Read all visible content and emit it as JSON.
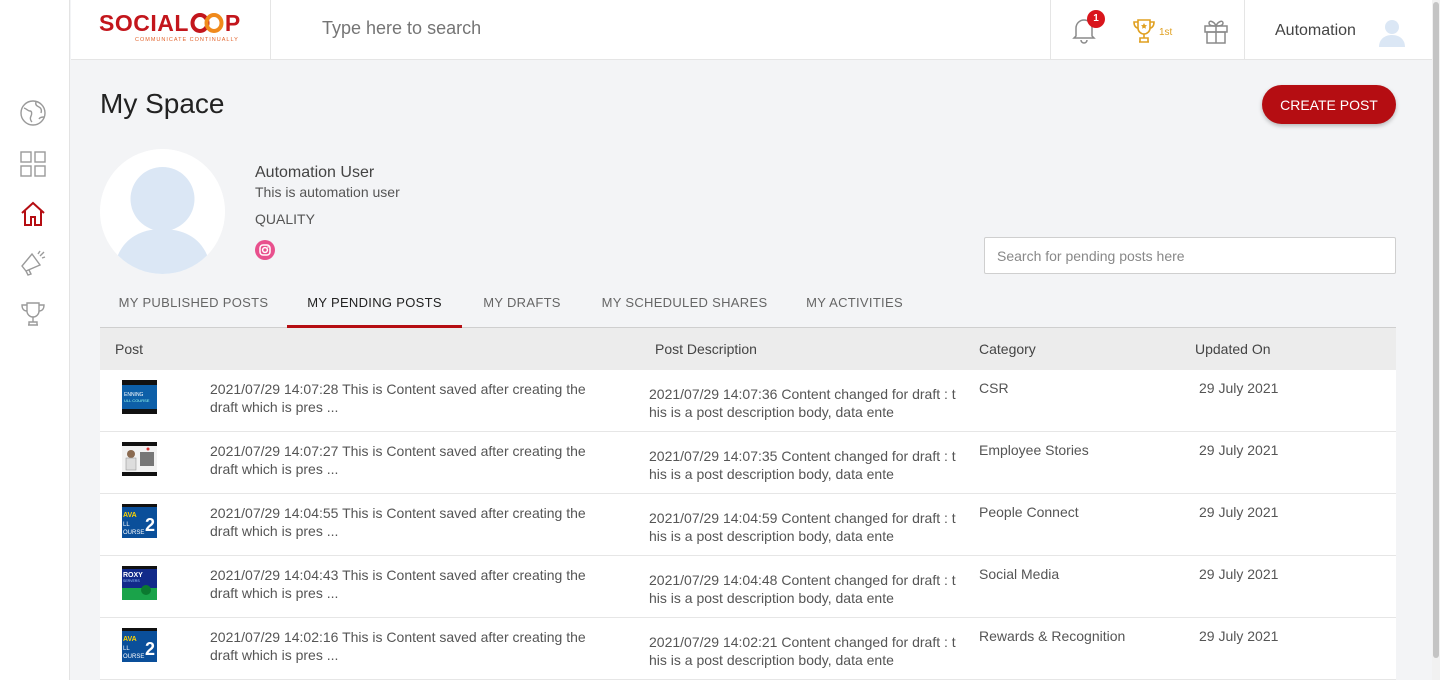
{
  "brand": {
    "logo_text_left": "SOCIAL",
    "logo_text_right": "P",
    "tagline": "COMMUNICATE CONTINUALLY",
    "primary_color": "#b50d12"
  },
  "topbar": {
    "search_placeholder": "Type here to search",
    "notification_count": "1",
    "rank": "1st",
    "username": "Automation"
  },
  "sidebar": {
    "items": [
      {
        "icon": "globe-icon",
        "active": false
      },
      {
        "icon": "grid-icon",
        "active": false
      },
      {
        "icon": "home-icon",
        "active": true
      },
      {
        "icon": "megaphone-icon",
        "active": false
      },
      {
        "icon": "trophy-icon",
        "active": false
      }
    ]
  },
  "page": {
    "title": "My Space",
    "create_button": "CREATE POST"
  },
  "profile": {
    "name": "Automation User",
    "description": "This is automation user",
    "department": "QUALITY",
    "social_icon": "instagram-icon"
  },
  "pending_search": {
    "placeholder": "Search for pending posts here"
  },
  "tabs": [
    {
      "label": "MY PUBLISHED POSTS",
      "active": false
    },
    {
      "label": "MY PENDING POSTS",
      "active": true
    },
    {
      "label": "MY DRAFTS",
      "active": false
    },
    {
      "label": "MY SCHEDULED SHARES",
      "active": false
    },
    {
      "label": "MY ACTIVITIES",
      "active": false
    }
  ],
  "table": {
    "headers": [
      "Post",
      "Post Description",
      "Category",
      "Updated On"
    ],
    "rows": [
      {
        "post": "2021/07/29 14:07:28 This is Content saved after creating the draft which is pres ...",
        "description": "2021/07/29 14:07:36 Content changed for draft : this is a post description body, data ente",
        "category": "CSR",
        "updated": "29 July 2021",
        "thumb": "blue"
      },
      {
        "post": "2021/07/29 14:07:27 This is Content saved after creating the draft which is pres ...",
        "description": "2021/07/29 14:07:35 Content changed for draft : this is a post description body, data ente",
        "category": "Employee Stories",
        "updated": "29 July 2021",
        "thumb": "person"
      },
      {
        "post": "2021/07/29 14:04:55 This is Content saved after creating the draft which is pres ...",
        "description": "2021/07/29 14:04:59 Content changed for draft : this is a post description body, data ente",
        "category": "People Connect",
        "updated": "29 July 2021",
        "thumb": "java"
      },
      {
        "post": "2021/07/29 14:04:43 This is Content saved after creating the draft which is pres ...",
        "description": "2021/07/29 14:04:48 Content changed for draft : this is a post description body, data ente",
        "category": "Social Media",
        "updated": "29 July 2021",
        "thumb": "proxy"
      },
      {
        "post": "2021/07/29 14:02:16 This is Content saved after creating the draft which is pres ...",
        "description": "2021/07/29 14:02:21 Content changed for draft : this is a post description body, data ente",
        "category": "Rewards & Recognition",
        "updated": "29 July 2021",
        "thumb": "java"
      }
    ]
  }
}
